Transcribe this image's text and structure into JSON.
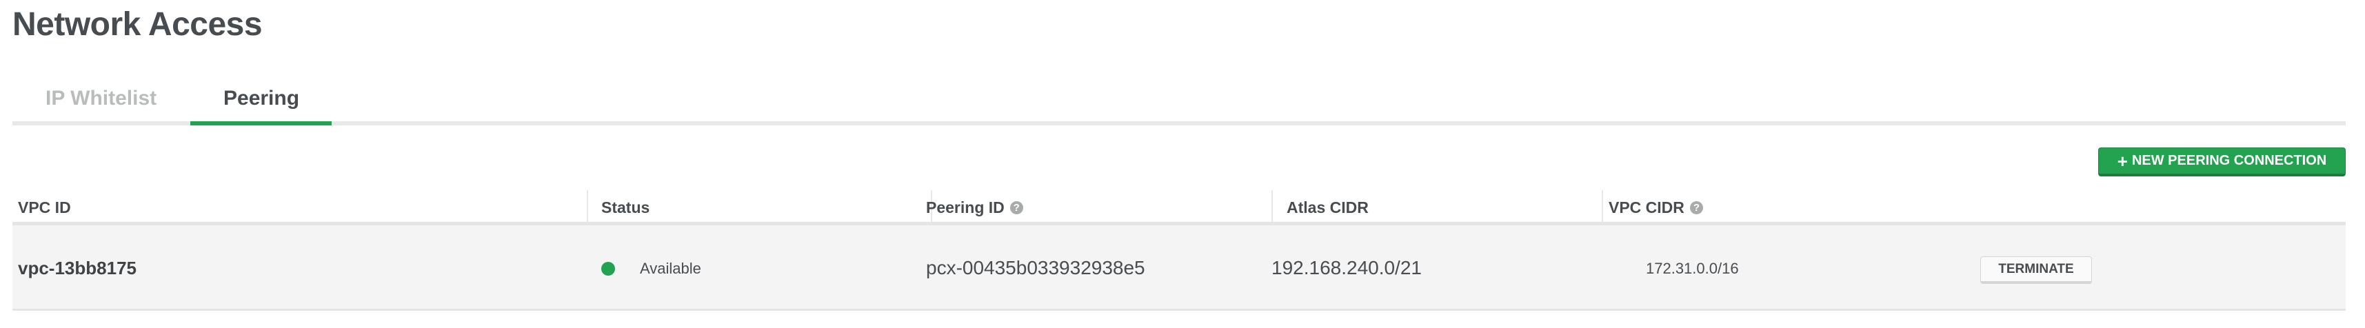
{
  "page_title": "Network Access",
  "tabs": [
    {
      "label": "IP Whitelist",
      "active": false
    },
    {
      "label": "Peering",
      "active": true
    }
  ],
  "toolbar": {
    "new_peering_label": "NEW PEERING CONNECTION",
    "plus_icon": "+"
  },
  "table": {
    "columns": [
      {
        "label": "VPC ID",
        "help": false
      },
      {
        "label": "Status",
        "help": false
      },
      {
        "label": "Peering ID",
        "help": true
      },
      {
        "label": "Atlas CIDR",
        "help": false
      },
      {
        "label": "VPC CIDR",
        "help": true
      }
    ],
    "help_glyph": "?",
    "rows": [
      {
        "vpc_id": "vpc-13bb8175",
        "status": "Available",
        "status_color": "#21a352",
        "peering_id": "pcx-00435b033932938e5",
        "atlas_cidr": "192.168.240.0/21",
        "vpc_cidr": "172.31.0.0/16",
        "action_label": "TERMINATE"
      }
    ]
  },
  "colors": {
    "accent": "#21a352",
    "row_bg": "#f3f4f3"
  }
}
